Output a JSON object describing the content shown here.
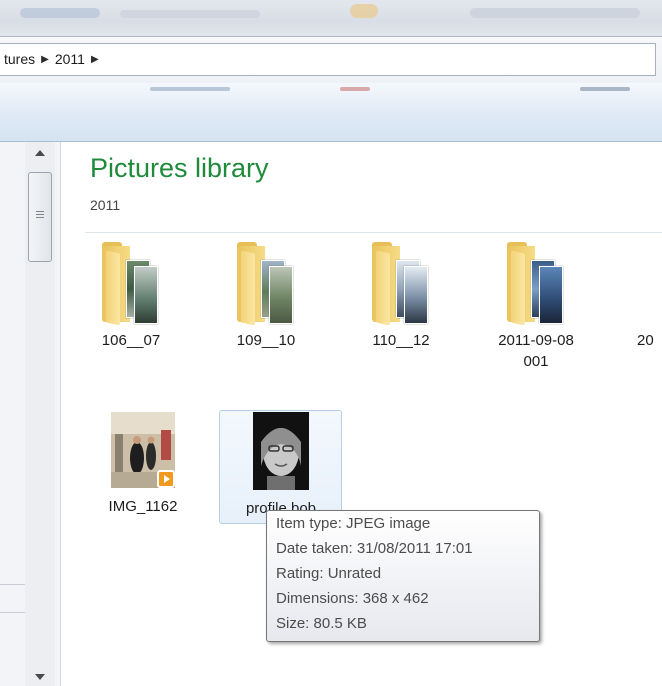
{
  "breadcrumb": {
    "items": [
      "tures",
      "2011"
    ]
  },
  "library": {
    "title": "Pictures library",
    "subtitle": "2011"
  },
  "items": [
    {
      "label": "106__07",
      "kind": "folder"
    },
    {
      "label": "109__10",
      "kind": "folder"
    },
    {
      "label": "110__12",
      "kind": "folder"
    },
    {
      "label_line1": "2011-09-08",
      "label_line2": "001",
      "kind": "folder"
    },
    {
      "label": "20",
      "kind": "folder-partial"
    },
    {
      "label": "IMG_1162",
      "kind": "video"
    },
    {
      "label": "profile bob",
      "kind": "image",
      "selected": true
    }
  ],
  "tooltip": {
    "item_type": "Item type: JPEG image",
    "date_taken": "Date taken: 31/08/2011 17:01",
    "rating": "Rating: Unrated",
    "dimensions": "Dimensions: 368 x 462",
    "size": "Size: 80.5 KB"
  },
  "colors": {
    "library_title": "#1e8a3a",
    "folder": "#f2cf6b",
    "selection": "#e7f0fa"
  },
  "icons": [
    "chevron-right-icon",
    "scroll-up-arrow-icon",
    "scroll-down-arrow-icon",
    "folder-icon",
    "video-overlay-icon"
  ]
}
